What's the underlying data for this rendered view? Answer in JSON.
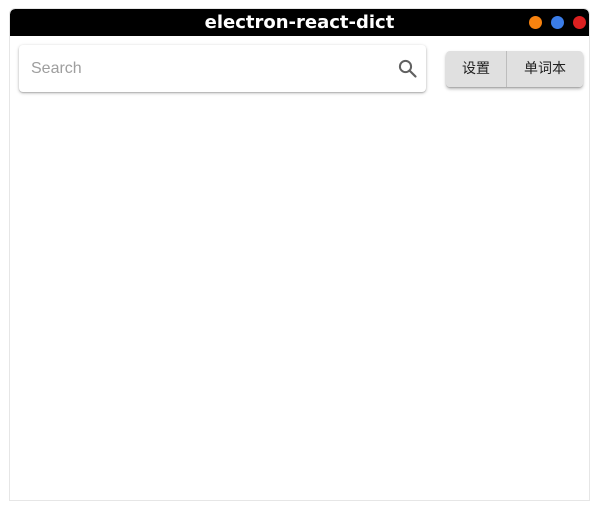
{
  "window": {
    "title": "electron-react-dict",
    "controls": [
      {
        "name": "minimize",
        "color": "#f7820f"
      },
      {
        "name": "maximize",
        "color": "#3b7de8"
      },
      {
        "name": "close",
        "color": "#dc2020"
      }
    ]
  },
  "search": {
    "placeholder": "Search",
    "value": "",
    "icon": "search-icon"
  },
  "toolbar": {
    "settings_label": "设置",
    "wordbook_label": "单词本"
  }
}
